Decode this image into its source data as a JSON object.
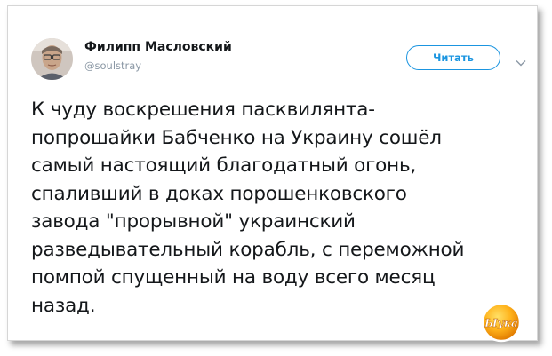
{
  "tweet": {
    "author_name": "Филипп Масловский",
    "author_handle": "@soulstray",
    "follow_label": "Читать",
    "text": "К чуду воскрешения пасквилянта-\nпопрошайки Бабченко на Украину сошёл\nсамый настоящий благодатный огонь,\nспаливший в доках порошенковского\nзавода \"прорывной\" украинский\nразведывательный корабль, с переможной\nпомпой спущенный на воду всего месяц\nназад."
  },
  "watermark": {
    "text": "Ыука"
  },
  "colors": {
    "accent": "#1b95e0",
    "text": "#14171a",
    "muted": "#8b98a5"
  },
  "icons": {
    "menu": "chevron-down-icon"
  }
}
